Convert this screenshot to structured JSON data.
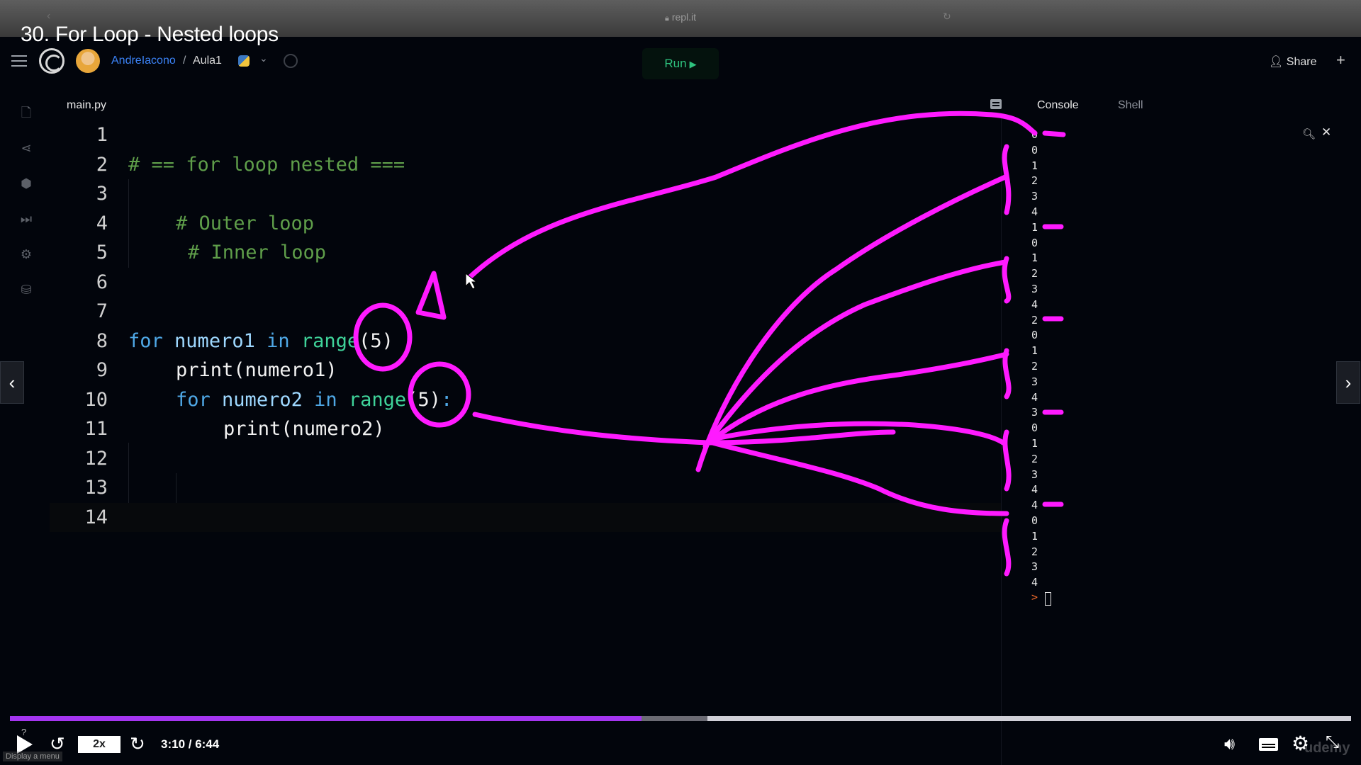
{
  "browser": {
    "url": "repl.it"
  },
  "lecture": {
    "title": "30. For Loop - Nested loops"
  },
  "header": {
    "user": "AndreIacono",
    "separator": "/",
    "repl_name": "Aula1",
    "run_label": "Run",
    "share_label": "Share"
  },
  "rail": {
    "icons": [
      "files-icon",
      "share-nodes-icon",
      "packages-icon",
      "debugger-icon",
      "settings-icon",
      "database-icon"
    ]
  },
  "editor": {
    "file_tab": "main.py",
    "line_numbers": [
      "1",
      "2",
      "3",
      "4",
      "5",
      "6",
      "7",
      "8",
      "9",
      "10",
      "11",
      "12",
      "13",
      "14"
    ],
    "lines": {
      "l2": "# == for loop nested ===",
      "l4": "# Outer loop",
      "l5": "# Inner loop",
      "l8_kw": "for",
      "l8_var": "numero1",
      "l8_in": "in",
      "l8_fn": "range",
      "l8_rest": "(5)",
      "l9": "print(numero1)",
      "l10_kw": "for",
      "l10_var": "numero2",
      "l10_in": "in",
      "l10_fn": "range",
      "l10_rest": "(5)",
      "l10_colon": ":",
      "l11": "print(numero2)"
    }
  },
  "console": {
    "tabs": [
      "Console",
      "Shell"
    ],
    "output": [
      "0",
      "0",
      "1",
      "2",
      "3",
      "4",
      "1",
      "0",
      "1",
      "2",
      "3",
      "4",
      "2",
      "0",
      "1",
      "2",
      "3",
      "4",
      "3",
      "0",
      "1",
      "2",
      "3",
      "4",
      "4",
      "0",
      "1",
      "2",
      "3",
      "4"
    ],
    "prompt": ">"
  },
  "player": {
    "progress": 0.471,
    "buffered": 0.52,
    "speed": "2x",
    "time": "3:10 / 6:44",
    "menu_hint": "Display a menu",
    "help_mark": "?",
    "watermark": "udemy"
  },
  "colors": {
    "annotation": "#ff1aff",
    "accent_progress": "#a435f0",
    "run_green": "#2ec27e",
    "comment": "#5f9e4a",
    "keyword": "#4fa8e6",
    "function": "#3fd39a"
  }
}
